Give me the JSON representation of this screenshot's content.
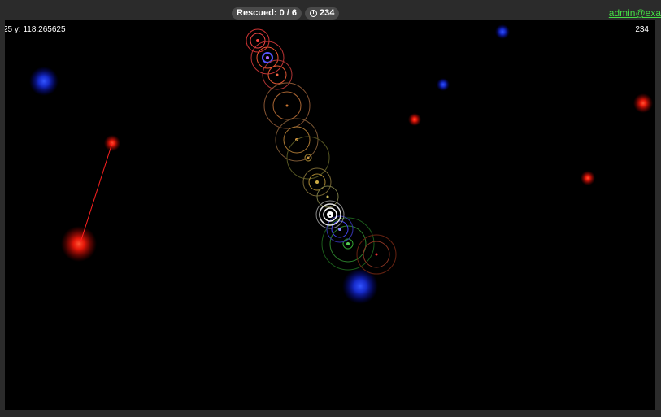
{
  "header": {
    "rescued_label": "Rescued: 0 / 6",
    "timer_label": "234",
    "user_label": "admin@exa"
  },
  "hud": {
    "coords_text": "25 y: 118.265625",
    "timer_readout": "234"
  },
  "colors": {
    "canvas_bg": "#000000",
    "accent_link": "#44dd44",
    "red_entity": "#ff2a1a",
    "blue_entity": "#2244ff"
  },
  "icons": {
    "timer": "clock-icon"
  }
}
